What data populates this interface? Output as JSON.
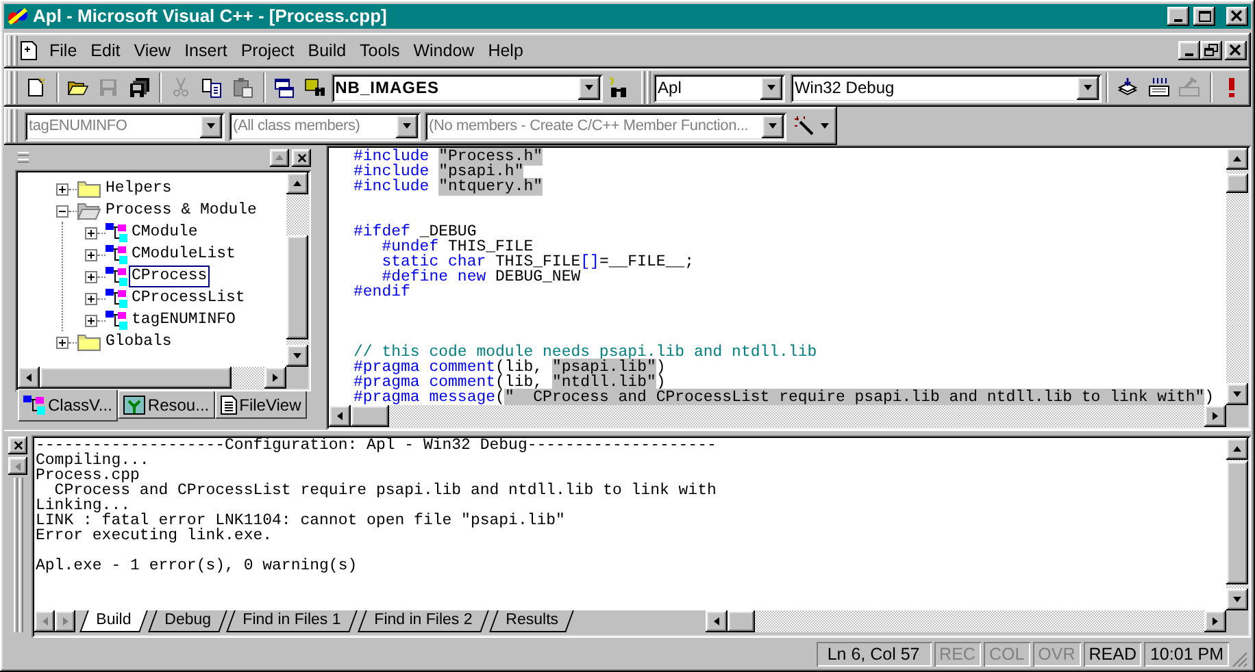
{
  "window": {
    "title": "Apl - Microsoft Visual C++ - [Process.cpp]"
  },
  "menu": [
    "File",
    "Edit",
    "View",
    "Insert",
    "Project",
    "Build",
    "Tools",
    "Window",
    "Help"
  ],
  "standard_toolbar": [
    {
      "kind": "new",
      "disabled": false
    },
    {
      "kind": "separator"
    },
    {
      "kind": "open",
      "disabled": false
    },
    {
      "kind": "save",
      "disabled": true
    },
    {
      "kind": "save_all",
      "disabled": false
    },
    {
      "kind": "separator"
    },
    {
      "kind": "cut",
      "disabled": true
    },
    {
      "kind": "copy",
      "disabled": false
    },
    {
      "kind": "paste",
      "disabled": true
    },
    {
      "kind": "separator"
    },
    {
      "kind": "workspace",
      "disabled": false
    },
    {
      "kind": "find_in_files",
      "disabled": false
    },
    {
      "kind": "combo",
      "value": "NB_IMAGES"
    },
    {
      "kind": "search",
      "disabled": false
    }
  ],
  "build_toolbar": {
    "project": "Apl",
    "configuration": "Win32 Debug",
    "buttons": [
      {
        "kind": "separator"
      },
      {
        "kind": "compile",
        "disabled": false
      },
      {
        "kind": "build",
        "disabled": false
      },
      {
        "kind": "stop_build",
        "disabled": true
      },
      {
        "kind": "separator"
      },
      {
        "kind": "execute",
        "disabled": false
      }
    ]
  },
  "wizard_bar": {
    "class": {
      "value": "tagENUMINFO",
      "disabled": true
    },
    "filter": {
      "value": "(All class members)",
      "disabled": true
    },
    "members": {
      "value": "(No members - Create C/C++ Member Function...",
      "disabled": true
    }
  },
  "workspace": {
    "tree": [
      {
        "kind": "folder",
        "label": "Helpers",
        "expanded": false,
        "selected": false
      },
      {
        "kind": "folder",
        "label": "Process & Module",
        "expanded": true,
        "selected": false,
        "children": [
          {
            "kind": "class",
            "label": "CModule",
            "expanded": false,
            "selected": false
          },
          {
            "kind": "class",
            "label": "CModuleList",
            "expanded": false,
            "selected": false
          },
          {
            "kind": "class",
            "label": "CProcess",
            "expanded": false,
            "selected": true
          },
          {
            "kind": "class",
            "label": "CProcessList",
            "expanded": false,
            "selected": false
          },
          {
            "kind": "class",
            "label": "tagENUMINFO",
            "expanded": false,
            "selected": false
          }
        ]
      },
      {
        "kind": "folder",
        "label": "Globals",
        "expanded": false,
        "selected": false
      }
    ],
    "tabs": [
      {
        "kind": "class",
        "label": "ClassV...",
        "selected": true
      },
      {
        "kind": "resource",
        "label": "Resou...",
        "selected": false
      },
      {
        "kind": "file",
        "label": "FileView",
        "selected": false
      }
    ]
  },
  "editor": {
    "lines": [
      {
        "kind": "code",
        "segments": [
          {
            "kind": "keyword",
            "text": "#include "
          },
          {
            "kind": "string",
            "text": "\"Process.h\""
          }
        ]
      },
      {
        "kind": "code",
        "segments": [
          {
            "kind": "keyword",
            "text": "#include "
          },
          {
            "kind": "string",
            "text": "\"psapi.h\""
          }
        ]
      },
      {
        "kind": "code",
        "segments": [
          {
            "kind": "keyword",
            "text": "#include "
          },
          {
            "kind": "string",
            "text": "\"ntquery.h\""
          }
        ]
      },
      {
        "kind": "blank"
      },
      {
        "kind": "blank"
      },
      {
        "kind": "code",
        "segments": [
          {
            "kind": "keyword",
            "text": "#ifdef"
          },
          {
            "kind": "plain",
            "text": " _DEBUG"
          }
        ]
      },
      {
        "kind": "code",
        "segments": [
          {
            "kind": "keyword",
            "text": "   #undef"
          },
          {
            "kind": "plain",
            "text": " THIS_FILE"
          }
        ]
      },
      {
        "kind": "code",
        "segments": [
          {
            "kind": "keyword",
            "text": "   static char"
          },
          {
            "kind": "plain",
            "text": " THIS_FILE"
          },
          {
            "kind": "keyword",
            "text": "[]"
          },
          {
            "kind": "plain",
            "text": "=__FILE__;"
          }
        ]
      },
      {
        "kind": "code",
        "segments": [
          {
            "kind": "keyword",
            "text": "   #define new"
          },
          {
            "kind": "plain",
            "text": " DEBUG_NEW"
          }
        ]
      },
      {
        "kind": "code",
        "segments": [
          {
            "kind": "keyword",
            "text": "#endif"
          }
        ]
      },
      {
        "kind": "blank"
      },
      {
        "kind": "blank"
      },
      {
        "kind": "blank"
      },
      {
        "kind": "code",
        "segments": [
          {
            "kind": "comment",
            "text": "// this code module needs psapi.lib and ntdll.lib"
          }
        ]
      },
      {
        "kind": "code",
        "segments": [
          {
            "kind": "keyword",
            "text": "#pragma comment"
          },
          {
            "kind": "plain",
            "text": "(lib, "
          },
          {
            "kind": "string",
            "text": "\"psapi.lib\""
          },
          {
            "kind": "plain",
            "text": ")"
          }
        ]
      },
      {
        "kind": "code",
        "segments": [
          {
            "kind": "keyword",
            "text": "#pragma comment"
          },
          {
            "kind": "plain",
            "text": "(lib, "
          },
          {
            "kind": "string",
            "text": "\"ntdll.lib\""
          },
          {
            "kind": "plain",
            "text": ")"
          }
        ]
      },
      {
        "kind": "code",
        "segments": [
          {
            "kind": "keyword",
            "text": "#pragma message"
          },
          {
            "kind": "plain",
            "text": "("
          },
          {
            "kind": "string",
            "text": "\"  CProcess and CProcessList require psapi.lib and ntdll.lib to link with\""
          },
          {
            "kind": "plain",
            "text": ")"
          }
        ]
      }
    ]
  },
  "output": {
    "lines": [
      {
        "kind": "text",
        "text": "--------------------Configuration: Apl - Win32 Debug--------------------"
      },
      {
        "kind": "text",
        "text": "Compiling..."
      },
      {
        "kind": "text",
        "text": "Process.cpp"
      },
      {
        "kind": "text",
        "text": "  CProcess and CProcessList require psapi.lib and ntdll.lib to link with"
      },
      {
        "kind": "text",
        "text": "Linking..."
      },
      {
        "kind": "text",
        "text": "LINK : fatal error LNK1104: cannot open file \"psapi.lib\""
      },
      {
        "kind": "text",
        "text": "Error executing link.exe."
      },
      {
        "kind": "blank"
      },
      {
        "kind": "text",
        "text": "Apl.exe - 1 error(s), 0 warning(s)"
      }
    ],
    "tabs": [
      {
        "label": "Build",
        "selected": true
      },
      {
        "label": "Debug",
        "selected": false
      },
      {
        "label": "Find in Files 1",
        "selected": false
      },
      {
        "label": "Find in Files 2",
        "selected": false
      },
      {
        "label": "Results",
        "selected": false
      }
    ]
  },
  "status_bar": {
    "panes": [
      {
        "text": "Ln 6, Col 57",
        "disabled": false
      },
      {
        "text": "REC",
        "disabled": true
      },
      {
        "text": "COL",
        "disabled": true
      },
      {
        "text": "OVR",
        "disabled": true
      },
      {
        "text": "READ",
        "disabled": false
      },
      {
        "text": "10:01 PM",
        "disabled": false
      }
    ]
  }
}
